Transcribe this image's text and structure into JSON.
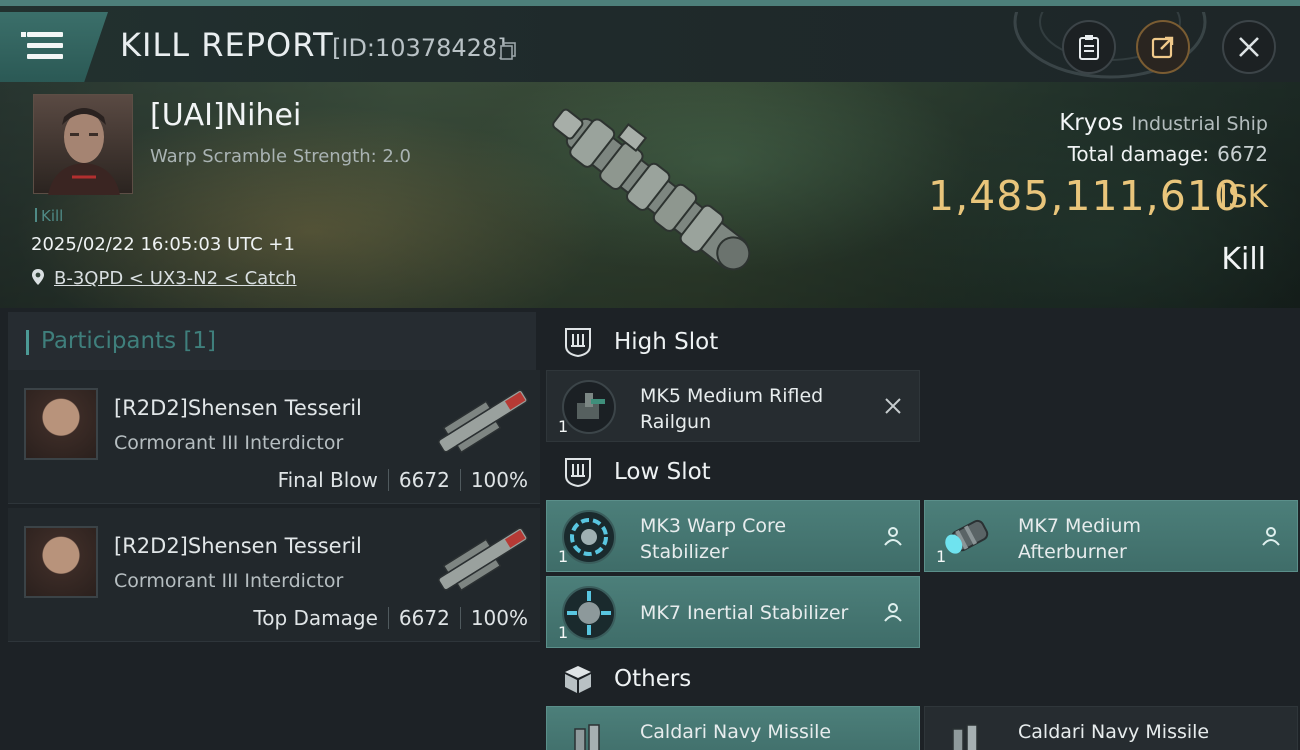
{
  "header": {
    "title": "KILL REPORT",
    "report_id": "[ID:10378428]"
  },
  "victim": {
    "name": "[UAI]Nihei",
    "warp_scramble": "Warp Scramble Strength: 2.0",
    "tag": "Kill",
    "time": "2025/02/22 16:05:03 UTC +1",
    "location": "B-3QPD < UX3-N2 < Catch"
  },
  "ship": {
    "name": "Kryos",
    "class": "Industrial Ship",
    "total_damage_label": "Total damage:",
    "total_damage": "6672",
    "isk_value": "1,485,111,610",
    "isk_unit": "ISK",
    "result": "Kill"
  },
  "participants": {
    "title": "Participants [1]",
    "rows": [
      {
        "name": "[R2D2]Shensen Tesseril",
        "ship": "Cormorant III Interdictor",
        "role": "Final Blow",
        "damage": "6672",
        "percent": "100%"
      },
      {
        "name": "[R2D2]Shensen Tesseril",
        "ship": "Cormorant III Interdictor",
        "role": "Top Damage",
        "damage": "6672",
        "percent": "100%"
      }
    ]
  },
  "slots": {
    "high": {
      "title": "High Slot",
      "modules": [
        {
          "name": "MK5 Medium Rifled Railgun",
          "qty": "1",
          "state": "destroyed"
        }
      ]
    },
    "low": {
      "title": "Low Slot",
      "modules": [
        {
          "name": "MK3 Warp Core Stabilizer",
          "qty": "1",
          "state": "dropped"
        },
        {
          "name": "MK7 Medium Afterburner",
          "qty": "1",
          "state": "dropped"
        },
        {
          "name": "MK7 Inertial Stabilizer",
          "qty": "1",
          "state": "dropped"
        }
      ]
    },
    "others": {
      "title": "Others",
      "modules": [
        {
          "name": "Caldari Navy Missile",
          "state": "dropped"
        },
        {
          "name": "Caldari Navy Missile",
          "state": "destroyed"
        }
      ]
    }
  },
  "colors": {
    "accent_teal": "#4c7f7a",
    "isk_gold": "#e9c57b",
    "background": "#1b2025"
  }
}
